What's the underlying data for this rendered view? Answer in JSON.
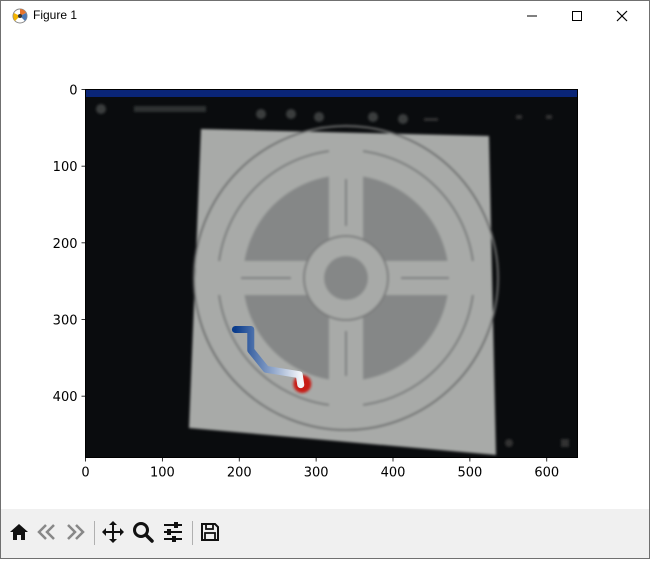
{
  "window": {
    "title": "Figure 1",
    "buttons": [
      "minimize",
      "maximize",
      "close"
    ]
  },
  "toolbar": {
    "items": [
      {
        "name": "home-icon",
        "tooltip": "Home"
      },
      {
        "name": "back-icon",
        "tooltip": "Back"
      },
      {
        "name": "forward-icon",
        "tooltip": "Forward"
      },
      {
        "name": "pan-icon",
        "tooltip": "Pan"
      },
      {
        "name": "zoom-icon",
        "tooltip": "Zoom"
      },
      {
        "name": "configure-subplots-icon",
        "tooltip": "Configure subplots"
      },
      {
        "name": "save-icon",
        "tooltip": "Save"
      }
    ]
  },
  "chart_data": {
    "type": "image",
    "xlim": [
      0,
      640
    ],
    "ylim": [
      480,
      0
    ],
    "x_ticks": [
      0,
      100,
      200,
      300,
      400,
      500,
      600
    ],
    "y_ticks": [
      0,
      100,
      200,
      300,
      400
    ],
    "overlay_path": [
      {
        "x": 195,
        "y": 313
      },
      {
        "x": 215,
        "y": 313
      },
      {
        "x": 215,
        "y": 340
      },
      {
        "x": 235,
        "y": 365
      },
      {
        "x": 278,
        "y": 372
      },
      {
        "x": 280,
        "y": 385
      }
    ],
    "marker": {
      "x": 282,
      "y": 384,
      "color": "#c81a14"
    }
  },
  "colors": {
    "image_bg": "#0a0c0e",
    "board": "#a8aaa8",
    "path_start": "#0a3c8c",
    "path_end": "#f4f6fa",
    "marker": "#c81a14"
  }
}
